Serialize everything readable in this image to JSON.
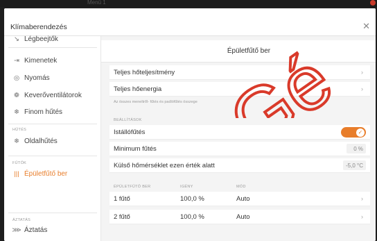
{
  "background_window": {
    "title": "Menü 1"
  },
  "dialog": {
    "title": "Klímaberendezés",
    "close_glyph": "✕"
  },
  "sidebar": {
    "items_top": [
      {
        "label": "Légbeejtők",
        "icon": "vent-icon"
      },
      {
        "label": "Kimenetek",
        "icon": "output-icon"
      },
      {
        "label": "Nyomás",
        "icon": "pressure-gauge-icon"
      },
      {
        "label": "Keverőventilátorok",
        "icon": "fan-icon"
      },
      {
        "label": "Finom hűtés",
        "icon": "cooling-icon"
      }
    ],
    "section_cooling": "HŰTÉS",
    "cooling_items": [
      {
        "label": "Oldalhűtés",
        "icon": "side-cooling-icon"
      }
    ],
    "section_heaters": "FŰTŐK",
    "heater_items": [
      {
        "label": "Épületfűtő ber",
        "icon": "heater-icon",
        "active": true
      }
    ],
    "section_ventilation": "ÁZTATÁS",
    "ventilation_items": [
      {
        "label": "Áztatás",
        "icon": "soaking-icon"
      }
    ]
  },
  "main": {
    "title": "Épületfűtő ber",
    "rows_summary": [
      {
        "label": "Teljes hőteljesítmény"
      },
      {
        "label": "Teljes hőenergia"
      }
    ],
    "note": "Az összes meneltről- fűtés és padlófűtés összege",
    "settings_section": "BEÁLLÍTÁSOK",
    "settings": {
      "stall_heating": {
        "label": "Istállófűtés",
        "enabled": true
      },
      "minimum_heating": {
        "label": "Minimum fűtés",
        "value": "0 %"
      },
      "outside_temp": {
        "label": "Külső hőmérséklet ezen érték alatt",
        "value": "-5,0 °C"
      }
    },
    "table": {
      "headers": [
        "ÉPÜLETFŰTŐ BER",
        "IGÉNY",
        "MÓD"
      ],
      "rows": [
        {
          "name": "1 fűtő",
          "demand": "100,0 %",
          "mode": "Auto"
        },
        {
          "name": "2 fűtő",
          "demand": "100,0 %",
          "mode": "Auto"
        }
      ]
    }
  },
  "watermark": {
    "text": "Gé",
    "color": "#d93a2a"
  },
  "colors": {
    "accent": "#e87d2a"
  }
}
